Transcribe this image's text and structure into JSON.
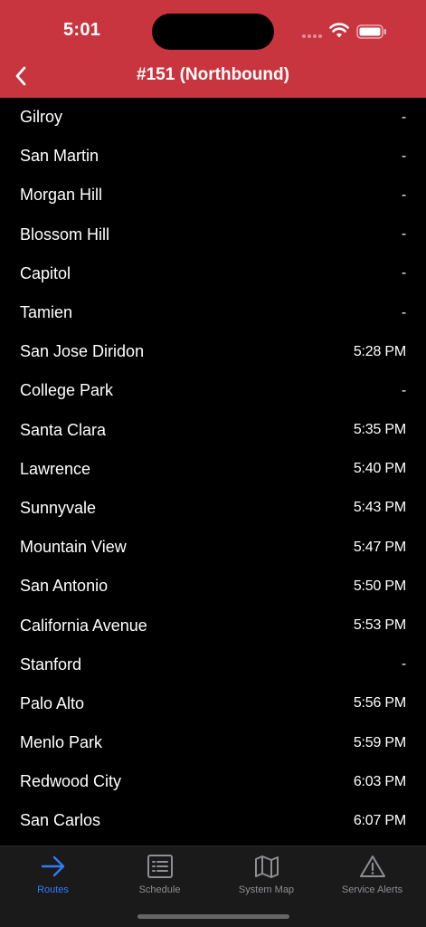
{
  "status_bar": {
    "time": "5:01"
  },
  "nav": {
    "title": "#151 (Northbound)"
  },
  "stops": [
    {
      "station": "Gilroy",
      "time": "-"
    },
    {
      "station": "San Martin",
      "time": "-"
    },
    {
      "station": "Morgan Hill",
      "time": "-"
    },
    {
      "station": "Blossom Hill",
      "time": "-"
    },
    {
      "station": "Capitol",
      "time": "-"
    },
    {
      "station": "Tamien",
      "time": "-"
    },
    {
      "station": "San Jose Diridon",
      "time": "5:28 PM"
    },
    {
      "station": "College Park",
      "time": "-"
    },
    {
      "station": "Santa Clara",
      "time": "5:35 PM"
    },
    {
      "station": "Lawrence",
      "time": "5:40 PM"
    },
    {
      "station": "Sunnyvale",
      "time": "5:43 PM"
    },
    {
      "station": "Mountain View",
      "time": "5:47 PM"
    },
    {
      "station": "San Antonio",
      "time": "5:50 PM"
    },
    {
      "station": "California Avenue",
      "time": "5:53 PM"
    },
    {
      "station": "Stanford",
      "time": "-"
    },
    {
      "station": "Palo Alto",
      "time": "5:56 PM"
    },
    {
      "station": "Menlo Park",
      "time": "5:59 PM"
    },
    {
      "station": "Redwood City",
      "time": "6:03 PM"
    },
    {
      "station": "San Carlos",
      "time": "6:07 PM"
    }
  ],
  "tabs": [
    {
      "label": "Routes",
      "icon": "arrow-right-icon",
      "active": true
    },
    {
      "label": "Schedule",
      "icon": "list-icon",
      "active": false
    },
    {
      "label": "System Map",
      "icon": "map-icon",
      "active": false
    },
    {
      "label": "Service Alerts",
      "icon": "warning-icon",
      "active": false
    }
  ],
  "colors": {
    "header": "#c8353e",
    "accent": "#2f7cf6",
    "background": "#000000",
    "tabbar": "#1a1a1a"
  }
}
